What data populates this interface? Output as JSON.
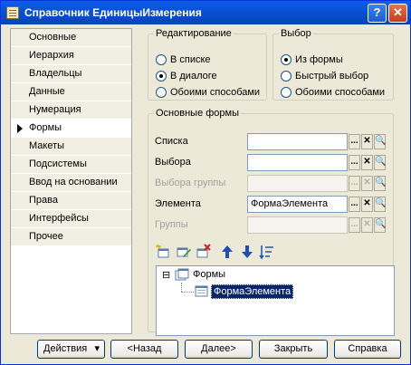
{
  "window": {
    "title": "Справочник ЕдиницыИзмерения",
    "help_label": "?",
    "close_label": "✕"
  },
  "tabs": [
    {
      "label": "Основные"
    },
    {
      "label": "Иерархия"
    },
    {
      "label": "Владельцы"
    },
    {
      "label": "Данные"
    },
    {
      "label": "Нумерация"
    },
    {
      "label": "Формы"
    },
    {
      "label": "Макеты"
    },
    {
      "label": "Подсистемы"
    },
    {
      "label": "Ввод на основании"
    },
    {
      "label": "Права"
    },
    {
      "label": "Интерфейсы"
    },
    {
      "label": "Прочее"
    }
  ],
  "active_tab": "Формы",
  "editing": {
    "legend": "Редактирование",
    "options": [
      "В списке",
      "В диалоге",
      "Обоими способами"
    ],
    "selected": "В диалоге"
  },
  "choice": {
    "legend": "Выбор",
    "options": [
      "Из формы",
      "Быстрый выбор",
      "Обоими способами"
    ],
    "selected": "Из формы"
  },
  "main_forms": {
    "legend": "Основные формы",
    "fields": [
      {
        "label": "Списка",
        "value": "",
        "enabled": true
      },
      {
        "label": "Выбора",
        "value": "",
        "enabled": true
      },
      {
        "label": "Выбора группы",
        "value": "",
        "enabled": false
      },
      {
        "label": "Элемента",
        "value": "ФормаЭлемента",
        "enabled": true
      },
      {
        "label": "Группы",
        "value": "",
        "enabled": false
      }
    ],
    "button_glyphs": {
      "select": "...",
      "clear": "✕",
      "open": "🔍"
    }
  },
  "tree": {
    "root_label": "Формы",
    "expander": "⊟",
    "child_label": "ФормаЭлемента"
  },
  "toolbar_icons": [
    "add-icon",
    "edit-icon",
    "delete-icon",
    "move-up-icon",
    "move-down-icon",
    "sort-icon"
  ],
  "bottom": {
    "actions_label": "Действия",
    "actions_arrow": "▾",
    "back_label": "<Назад",
    "next_label": "Далее>",
    "close_label": "Закрыть",
    "help_label": "Справка"
  },
  "colors": {
    "accent": "#0A246A",
    "titlebar": "#0852D6",
    "selection": "#0A246A"
  }
}
